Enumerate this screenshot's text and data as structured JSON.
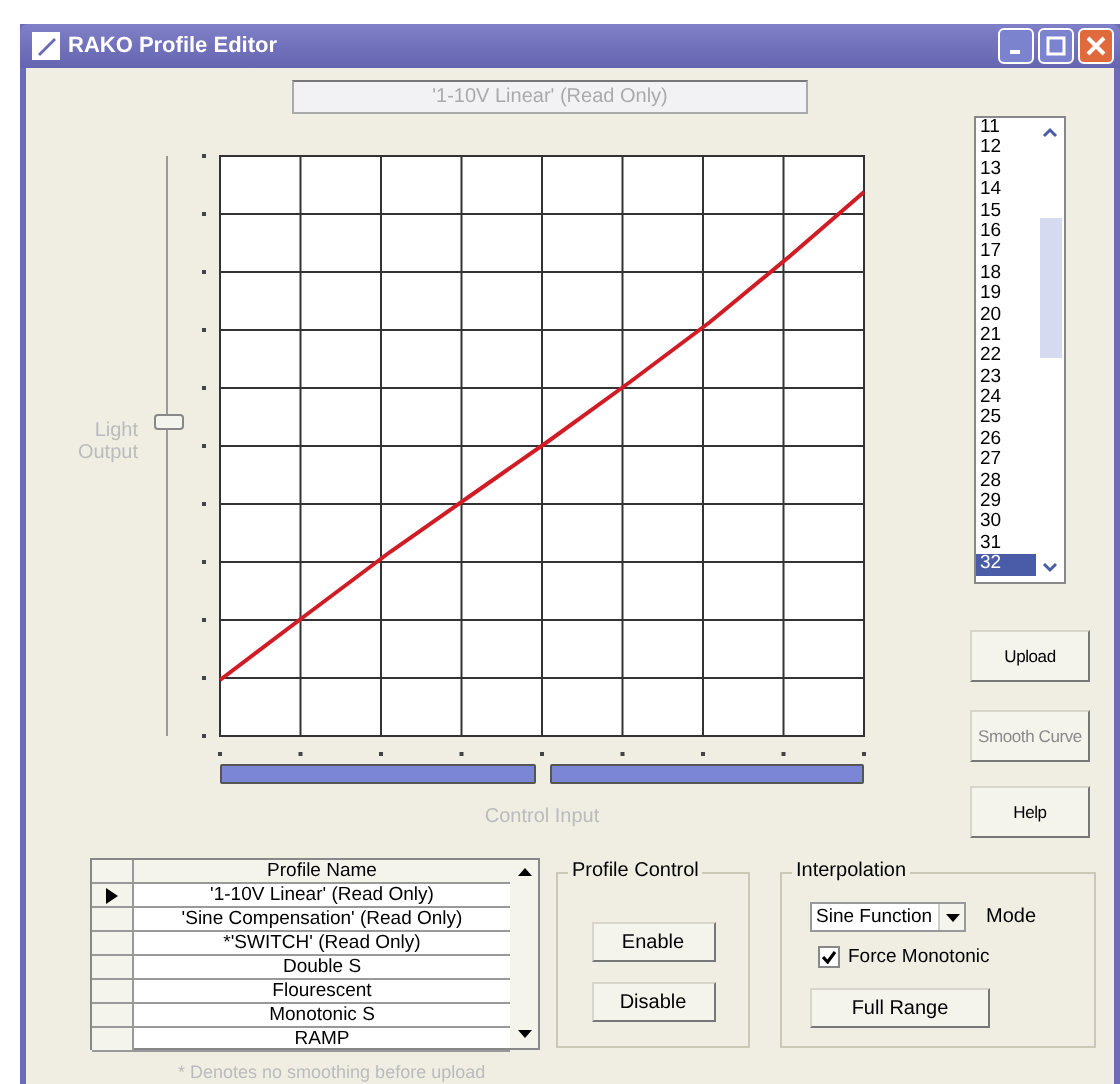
{
  "window": {
    "title": "RAKO Profile Editor"
  },
  "profile_field": {
    "value": "'1-10V Linear' (Read Only)",
    "disabled": true
  },
  "light_output": {
    "label": "Light Output",
    "level": 0.54
  },
  "control_input": {
    "label": "Control Input"
  },
  "point_list": [
    {
      "label": "11",
      "selected": false
    },
    {
      "label": "12",
      "selected": false
    },
    {
      "label": "13",
      "selected": false
    },
    {
      "label": "14",
      "selected": false
    },
    {
      "label": "15",
      "selected": false
    },
    {
      "label": "16",
      "selected": false
    },
    {
      "label": "17",
      "selected": false
    },
    {
      "label": "18",
      "selected": false
    },
    {
      "label": "19",
      "selected": false
    },
    {
      "label": "20",
      "selected": false
    },
    {
      "label": "21",
      "selected": false
    },
    {
      "label": "22",
      "selected": false
    },
    {
      "label": "23",
      "selected": false
    },
    {
      "label": "24",
      "selected": false
    },
    {
      "label": "25",
      "selected": false
    },
    {
      "label": "26",
      "selected": false
    },
    {
      "label": "27",
      "selected": false
    },
    {
      "label": "28",
      "selected": false
    },
    {
      "label": "29",
      "selected": false
    },
    {
      "label": "30",
      "selected": false
    },
    {
      "label": "31",
      "selected": false
    },
    {
      "label": "32",
      "selected": true
    }
  ],
  "buttons": [
    {
      "label": "Upload",
      "disabled": false
    },
    {
      "label": "Smooth Curve",
      "disabled": true
    },
    {
      "label": "Help",
      "disabled": false
    }
  ],
  "profiles": {
    "column": "Profile Name",
    "rows": [
      {
        "name": "'1-10V Linear' (Read Only)",
        "selected": true
      },
      {
        "name": "'Sine Compensation' (Read Only)",
        "selected": false
      },
      {
        "name": "*'SWITCH' (Read Only)",
        "selected": false
      },
      {
        "name": "Double S",
        "selected": false
      },
      {
        "name": "Flourescent",
        "selected": false
      },
      {
        "name": "Monotonic S",
        "selected": false
      },
      {
        "name": "RAMP",
        "selected": false
      }
    ]
  },
  "profile_control": {
    "title": "Profile Control",
    "buttons": [
      "Enable",
      "Disable"
    ]
  },
  "interpolation": {
    "title": "Interpolation",
    "select": "Sine Function",
    "mode_label": "Mode",
    "force_monotonic": {
      "label": "Force Monotonic",
      "checked": true
    },
    "button": "Full Range"
  },
  "footnote": "* Denotes no smoothing before upload"
}
